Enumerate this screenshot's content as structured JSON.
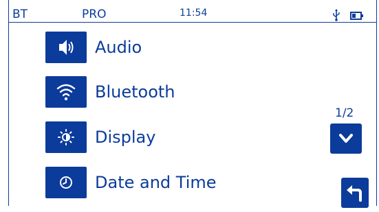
{
  "status": {
    "bt_label": "BT",
    "mode_label": "PRO",
    "time": "11:54",
    "usb_icon": "usb-icon",
    "battery_icon": "battery-icon"
  },
  "menu": {
    "items": [
      {
        "label": "Audio",
        "icon": "speaker-icon"
      },
      {
        "label": "Bluetooth",
        "icon": "wifi-signal-icon"
      },
      {
        "label": "Display",
        "icon": "brightness-icon"
      },
      {
        "label": "Date and Time",
        "icon": "clock-icon"
      }
    ]
  },
  "pagination": {
    "indicator": "1/2",
    "next_icon": "chevron-down-icon"
  },
  "navigation": {
    "back_icon": "back-arrow-icon"
  },
  "colors": {
    "accent": "#0b3c9b",
    "background": "#ffffff"
  }
}
